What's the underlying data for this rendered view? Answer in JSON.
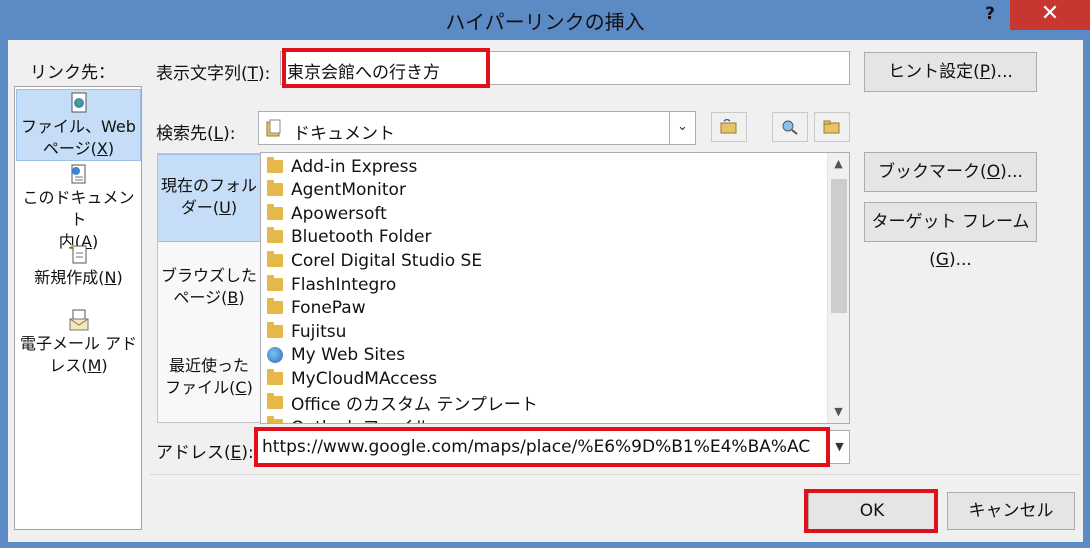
{
  "window": {
    "title": "ハイパーリンクの挿入",
    "help": "?",
    "close": "✕"
  },
  "link_to": {
    "label": "リンク先：",
    "items": [
      {
        "line1": "ファイル、Web",
        "line2_pre": "ページ(",
        "key": "X",
        "line2_post": ")",
        "icon": "web-page-icon",
        "selected": true
      },
      {
        "line1": "このドキュメント",
        "line2_pre": "内(",
        "key": "A",
        "line2_post": ")",
        "icon": "document-place-icon",
        "selected": false
      },
      {
        "line1": "",
        "line2_pre": "新規作成(",
        "key": "N",
        "line2_post": ")",
        "icon": "new-document-icon",
        "selected": false
      },
      {
        "line1": "電子メール アド",
        "line2_pre": "レス(",
        "key": "M",
        "line2_post": ")",
        "icon": "email-icon",
        "selected": false
      }
    ]
  },
  "display_text": {
    "label_pre": "表示文字列(",
    "key": "T",
    "label_post": "):",
    "value": "東京会館への行き方"
  },
  "screentip_button": {
    "pre": "ヒント設定(",
    "key": "P",
    "post": ")..."
  },
  "look_in": {
    "label_pre": "検索先(",
    "key": "L",
    "label_post": "):",
    "value": "ドキュメント",
    "arrow": "⌄"
  },
  "tool_buttons": [
    "browse-folder-icon",
    "browse-web-icon",
    "browse-file-icon"
  ],
  "inner_nav": [
    {
      "line1": "現在のフォル",
      "line2_pre": "ダー(",
      "key": "U",
      "line2_post": ")",
      "selected": true
    },
    {
      "line1": "ブラウズした",
      "line2_pre": "ページ(",
      "key": "B",
      "line2_post": ")",
      "selected": false
    },
    {
      "line1": "最近使った",
      "line2_pre": "ファイル(",
      "key": "C",
      "line2_post": ")",
      "selected": false
    }
  ],
  "files": [
    {
      "name": "Add-in Express",
      "icon": "folder-icon"
    },
    {
      "name": "AgentMonitor",
      "icon": "folder-icon"
    },
    {
      "name": "Apowersoft",
      "icon": "folder-icon"
    },
    {
      "name": "Bluetooth Folder",
      "icon": "folder-icon"
    },
    {
      "name": "Corel Digital Studio SE",
      "icon": "folder-icon"
    },
    {
      "name": "FlashIntegro",
      "icon": "folder-icon"
    },
    {
      "name": "FonePaw",
      "icon": "folder-icon"
    },
    {
      "name": "Fujitsu",
      "icon": "folder-icon"
    },
    {
      "name": "My Web Sites",
      "icon": "web-sites-icon"
    },
    {
      "name": "MyCloudMAccess",
      "icon": "folder-icon"
    },
    {
      "name": "Office のカスタム テンプレート",
      "icon": "folder-icon"
    },
    {
      "name": "Outlook ファイル",
      "icon": "folder-icon"
    }
  ],
  "bookmark_button": {
    "pre": "ブックマーク(",
    "key": "O",
    "post": ")..."
  },
  "target_frame_button": {
    "pre": "ターゲット フレーム(",
    "key": "G",
    "post": ")..."
  },
  "address": {
    "label_pre": "アドレス(",
    "key": "E",
    "label_post": "):",
    "value": "https://www.google.com/maps/place/%E6%9D%B1%E4%BA%AC"
  },
  "ok_button": "OK",
  "cancel_button": "キャンセル",
  "colors": {
    "title_bar": "#5c8ac5",
    "close_button": "#c7372f",
    "highlight_box": "#e0101b",
    "selection": "#c5ddf6"
  }
}
